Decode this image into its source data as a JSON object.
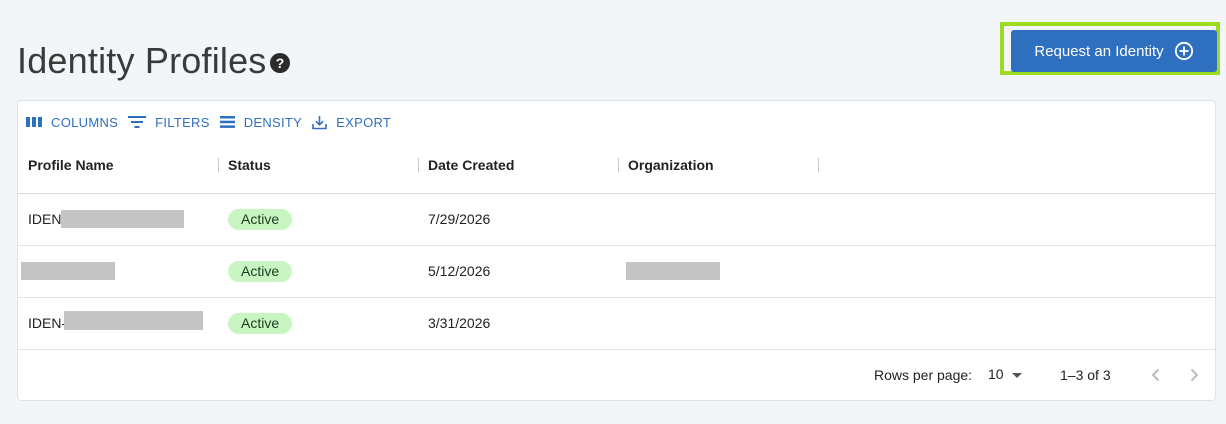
{
  "page": {
    "title": "Identity Profiles",
    "help_symbol": "?",
    "request_button_label": "Request an Identity"
  },
  "toolbar": {
    "columns_label": "COLUMNS",
    "filters_label": "FILTERS",
    "density_label": "DENSITY",
    "export_label": "EXPORT"
  },
  "table": {
    "headers": [
      "Profile Name",
      "Status",
      "Date Created",
      "Organization"
    ],
    "rows": [
      {
        "profile_name": "IDEN-",
        "status": "Active",
        "date_created": "7/29/2026",
        "organization": ""
      },
      {
        "profile_name": "",
        "status": "Active",
        "date_created": "5/12/2026",
        "organization": ""
      },
      {
        "profile_name": "IDEN-",
        "status": "Active",
        "date_created": "3/31/2026",
        "organization": ""
      }
    ]
  },
  "pagination": {
    "rows_per_page_label": "Rows per page:",
    "rows_per_page_value": "10",
    "range_text": "1–3 of 3"
  },
  "colors": {
    "accent": "#2f6fbf",
    "highlight": "#9cdb1f",
    "status_active_bg": "#c9f5c3",
    "redaction": "#c4c4c4"
  }
}
